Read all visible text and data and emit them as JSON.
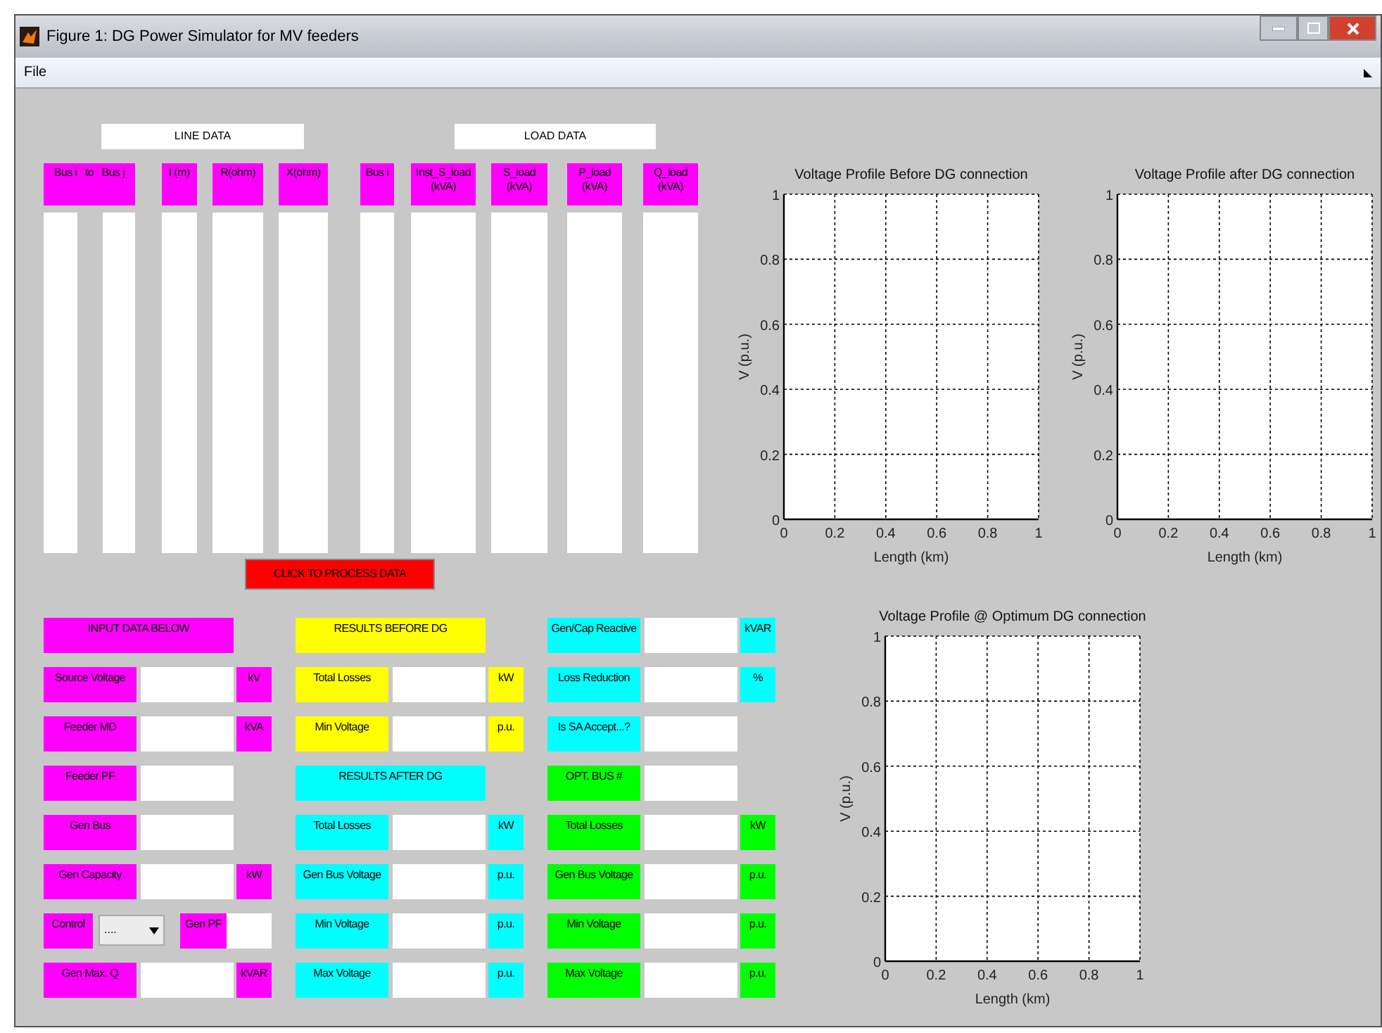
{
  "window": {
    "title": "Figure 1: DG Power Simulator for MV feeders"
  },
  "menu": [
    "File"
  ],
  "line_data": {
    "title": "LINE DATA",
    "columns": [
      {
        "kind": "pair",
        "label": "Bus i   to   Bus j"
      },
      {
        "kind": "single",
        "label": "l (m)"
      },
      {
        "kind": "single",
        "label": "R(ohm)"
      },
      {
        "kind": "single",
        "label": "X(ohm)"
      }
    ]
  },
  "load_data": {
    "title": "LOAD DATA",
    "columns": [
      {
        "kind": "single",
        "label": "Bus i"
      },
      {
        "kind": "single",
        "label": "Inst_S_load (kVA)"
      },
      {
        "kind": "single",
        "label": "S_load (kVA)"
      },
      {
        "kind": "single",
        "label": "P_load (kVA)"
      },
      {
        "kind": "single",
        "label": "Q_load (kVA)"
      }
    ]
  },
  "process_button": {
    "label": "CLICK TO PROCESS DATA"
  },
  "panels": [
    {
      "rows": [
        {
          "kind": "header",
          "label": "INPUT DATA BELOW",
          "color": "#ff00ff"
        },
        {
          "kind": "field",
          "label": "Source Voltage",
          "unit": "kV",
          "color": "#ff00ff"
        },
        {
          "kind": "field",
          "label": "Feeder MD",
          "unit": "kVA",
          "color": "#ff00ff"
        },
        {
          "kind": "field",
          "label": "Feeder PF",
          "color": "#ff00ff"
        },
        {
          "kind": "field",
          "label": "Gen Bus",
          "color": "#ff00ff"
        },
        {
          "kind": "field",
          "label": "Gen Capacity",
          "unit": "kW",
          "color": "#ff00ff"
        },
        {
          "kind": "control",
          "label": "Control",
          "value": "....",
          "label2": "Gen PF",
          "color": "#ff00ff"
        },
        {
          "kind": "field",
          "label": "Gen Max. Q",
          "unit": "kVAR",
          "color": "#ff00ff"
        }
      ]
    },
    {
      "rows": [
        {
          "kind": "header",
          "label": "RESULTS BEFORE DG",
          "color": "#ffff00"
        },
        {
          "kind": "field",
          "label": "Total Losses",
          "unit": "kW",
          "color": "#ffff00"
        },
        {
          "kind": "field",
          "label": "Min Voltage",
          "unit": "p.u.",
          "color": "#ffff00"
        },
        {
          "kind": "header",
          "label": "RESULTS AFTER DG",
          "color": "#00ffff"
        },
        {
          "kind": "field",
          "label": "Total Losses",
          "unit": "kW",
          "color": "#00ffff"
        },
        {
          "kind": "field",
          "label": "Gen Bus Voltage",
          "unit": "p.u.",
          "color": "#00ffff"
        },
        {
          "kind": "field",
          "label": "Min Voltage",
          "unit": "p.u.",
          "color": "#00ffff"
        },
        {
          "kind": "field",
          "label": "Max Voltage",
          "unit": "p.u.",
          "color": "#00ffff"
        }
      ]
    },
    {
      "rows": [
        {
          "kind": "field",
          "label": "Gen/Cap Reactive",
          "unit": "kVAR",
          "color": "#00ffff"
        },
        {
          "kind": "field",
          "label": "Loss Reduction",
          "unit": "%",
          "color": "#00ffff"
        },
        {
          "kind": "field",
          "label": "Is SA Accept...?",
          "color": "#00ffff"
        },
        {
          "kind": "field",
          "label": "OPT. BUS #",
          "color": "#00ff00"
        },
        {
          "kind": "field",
          "label": "Total Losses",
          "unit": "kW",
          "color": "#00ff00"
        },
        {
          "kind": "field",
          "label": "Gen Bus Voltage",
          "unit": "p.u.",
          "color": "#00ff00"
        },
        {
          "kind": "field",
          "label": "Min Voltage",
          "unit": "p.u.",
          "color": "#00ff00"
        },
        {
          "kind": "field",
          "label": "Max Voltage",
          "unit": "p.u.",
          "color": "#00ff00"
        }
      ]
    }
  ],
  "charts": [
    {
      "chart_data": {
        "type": "line",
        "grid": true,
        "title": "Voltage Profile Before DG connection",
        "xlabel": "Length (km)",
        "ylabel": "V (p.u.)",
        "xlim": [
          0,
          1
        ],
        "ylim": [
          0,
          1
        ],
        "xticks": [
          0,
          0.2,
          0.4,
          0.6,
          0.8,
          1
        ],
        "yticks": [
          0,
          0.2,
          0.4,
          0.6,
          0.8,
          1
        ]
      }
    },
    {
      "chart_data": {
        "type": "line",
        "grid": true,
        "title": "Voltage Profile after DG connection",
        "xlabel": "Length (km)",
        "ylabel": "V (p.u.)",
        "xlim": [
          0,
          1
        ],
        "ylim": [
          0,
          1
        ],
        "xticks": [
          0,
          0.2,
          0.4,
          0.6,
          0.8,
          1
        ],
        "yticks": [
          0,
          0.2,
          0.4,
          0.6,
          0.8,
          1
        ]
      }
    },
    {
      "chart_data": {
        "type": "line",
        "grid": true,
        "title": "Voltage Profile @ Optimum DG connection",
        "xlabel": "Length (km)",
        "ylabel": "V (p.u.)",
        "xlim": [
          0,
          1
        ],
        "ylim": [
          0,
          1
        ],
        "xticks": [
          0,
          0.2,
          0.4,
          0.6,
          0.8,
          1
        ],
        "yticks": [
          0,
          0.2,
          0.4,
          0.6,
          0.8,
          1
        ]
      }
    }
  ]
}
